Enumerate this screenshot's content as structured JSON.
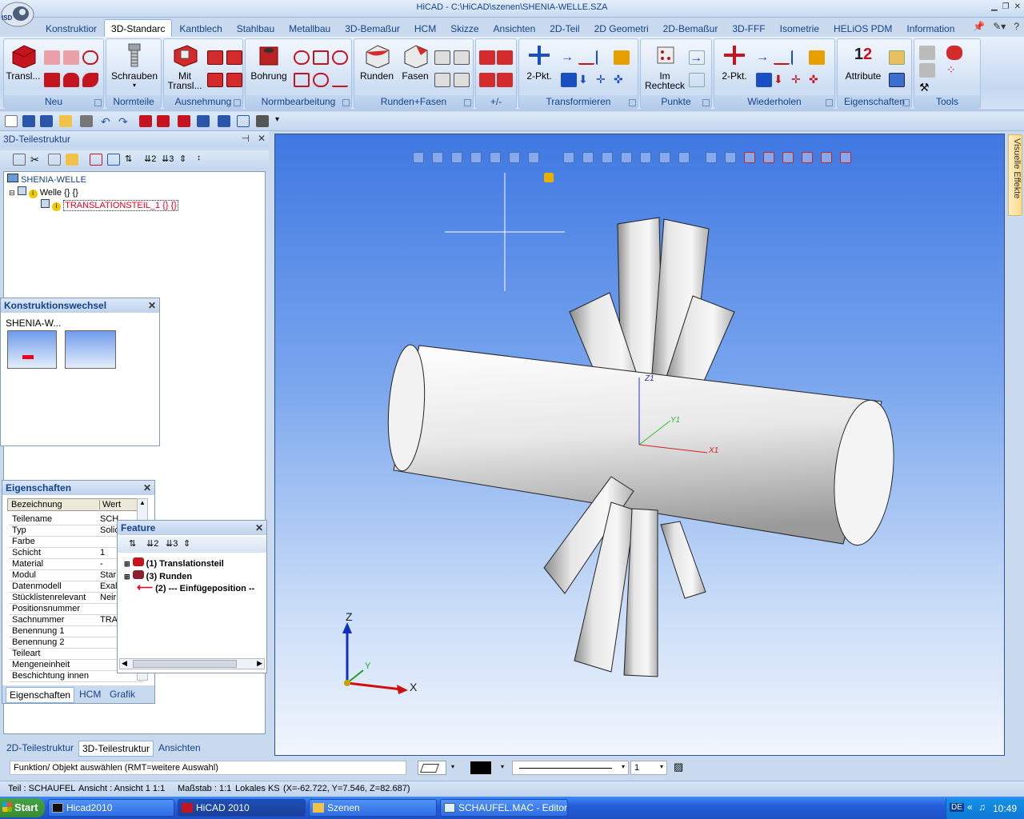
{
  "window": {
    "title": "HiCAD - C:\\HiCAD\\szenen\\SHENIA-WELLE.SZA",
    "logo_text": "ISD"
  },
  "ribbon_tabs": [
    "Konstruktior",
    "3D-Standarc",
    "Kantblech",
    "Stahlbau",
    "Metallbau",
    "3D-Bemaßur",
    "HCM",
    "Skizze",
    "Ansichten",
    "2D-Teil",
    "2D Geometri",
    "2D-Bemaßur",
    "3D-FFF",
    "Isometrie",
    "HELiOS PDM",
    "Information"
  ],
  "active_tab_index": 1,
  "ribbon": {
    "groups": {
      "neu": "Neu",
      "normteile": "Normteile",
      "ausnehmung": "Ausnehmung",
      "normbearbeitung": "Normbearbeitung",
      "runden_fasen": "Runden+Fasen",
      "plusminus": "+/-",
      "transformieren": "Transformieren",
      "punkte": "Punkte",
      "wiederholen": "Wiederholen",
      "eigenschaften": "Eigenschaften",
      "tools": "Tools"
    },
    "buttons": {
      "transl": "Transl...",
      "schrauben": "Schrauben",
      "mit_transl_1": "Mit",
      "mit_transl_2": "Transl...",
      "bohrung": "Bohrung",
      "runden": "Runden",
      "fasen": "Fasen",
      "zwei_pkt_a": "2-Pkt.",
      "im_rechteck_1": "Im",
      "im_rechteck_2": "Rechteck",
      "zwei_pkt_b": "2-Pkt.",
      "attribute": "Attribute"
    }
  },
  "left_panel": {
    "title": "3D-Teilestruktur",
    "tree": [
      {
        "label": "SHENIA-WELLE"
      },
      {
        "label": "Welle {} {}"
      },
      {
        "label": "TRANSLATIONSTEIL_1 {} {}"
      }
    ],
    "bottom_tabs": [
      "2D-Teilestruktur",
      "3D-Teilestruktur",
      "Ansichten"
    ]
  },
  "konstruktionswechsel": {
    "title": "Konstruktionswechsel",
    "label": "SHENIA-W..."
  },
  "eigenschaften": {
    "title": "Eigenschaften",
    "headers": [
      "Bezeichnung",
      "Wert"
    ],
    "rows": [
      [
        "Teilename",
        "SCH"
      ],
      [
        "Typ",
        "Solic"
      ],
      [
        "Farbe",
        ""
      ],
      [
        "Schicht",
        "1"
      ],
      [
        "Material",
        "-"
      ],
      [
        "Modul",
        "Star"
      ],
      [
        "Datenmodell",
        "Exal"
      ],
      [
        "Stücklistenrelevant",
        "Neir"
      ],
      [
        "Positionsnummer",
        ""
      ],
      [
        "Sachnummer",
        "TRA"
      ],
      [
        "Benennung 1",
        ""
      ],
      [
        "Benennung 2",
        ""
      ],
      [
        "Teileart",
        ""
      ],
      [
        "Mengeneinheit",
        ""
      ],
      [
        "Beschichtung innen",
        ""
      ]
    ],
    "tabs": [
      "Eigenschaften",
      "HCM",
      "Grafik"
    ]
  },
  "feature": {
    "title": "Feature",
    "items": [
      "(1) Translationsteil",
      "(3) Runden",
      "(2) --- Einfügeposition --"
    ]
  },
  "viewport": {
    "axes_local": {
      "z": "Z1",
      "y": "Y1",
      "x": "X1"
    },
    "axes_triad": {
      "z": "Z",
      "y": "Y",
      "x": "X"
    }
  },
  "side_tab": "Visuelle Effekte",
  "command": {
    "text": "Funktion/ Objekt auswählen (RMT=weitere Auswahl)",
    "line_width": "1"
  },
  "status": {
    "teil": "Teil : SCHAUFEL",
    "ansicht": "Ansicht : Ansicht 1 1:1",
    "massstab": "Maßstab : 1:1",
    "ks": "Lokales KS",
    "coords": "(X=-62.722, Y=7.546, Z=82.687)"
  },
  "taskbar": {
    "start": "Start",
    "tasks": [
      "Hicad2010",
      "HiCAD 2010",
      "Szenen",
      "SCHAUFEL.MAC - Editor"
    ],
    "active_task": 1,
    "lang": "DE",
    "time": "10:49"
  },
  "colors": {
    "accent": "#15428b",
    "selected": "#e8001c",
    "viewport_top": "#3f78e2"
  }
}
